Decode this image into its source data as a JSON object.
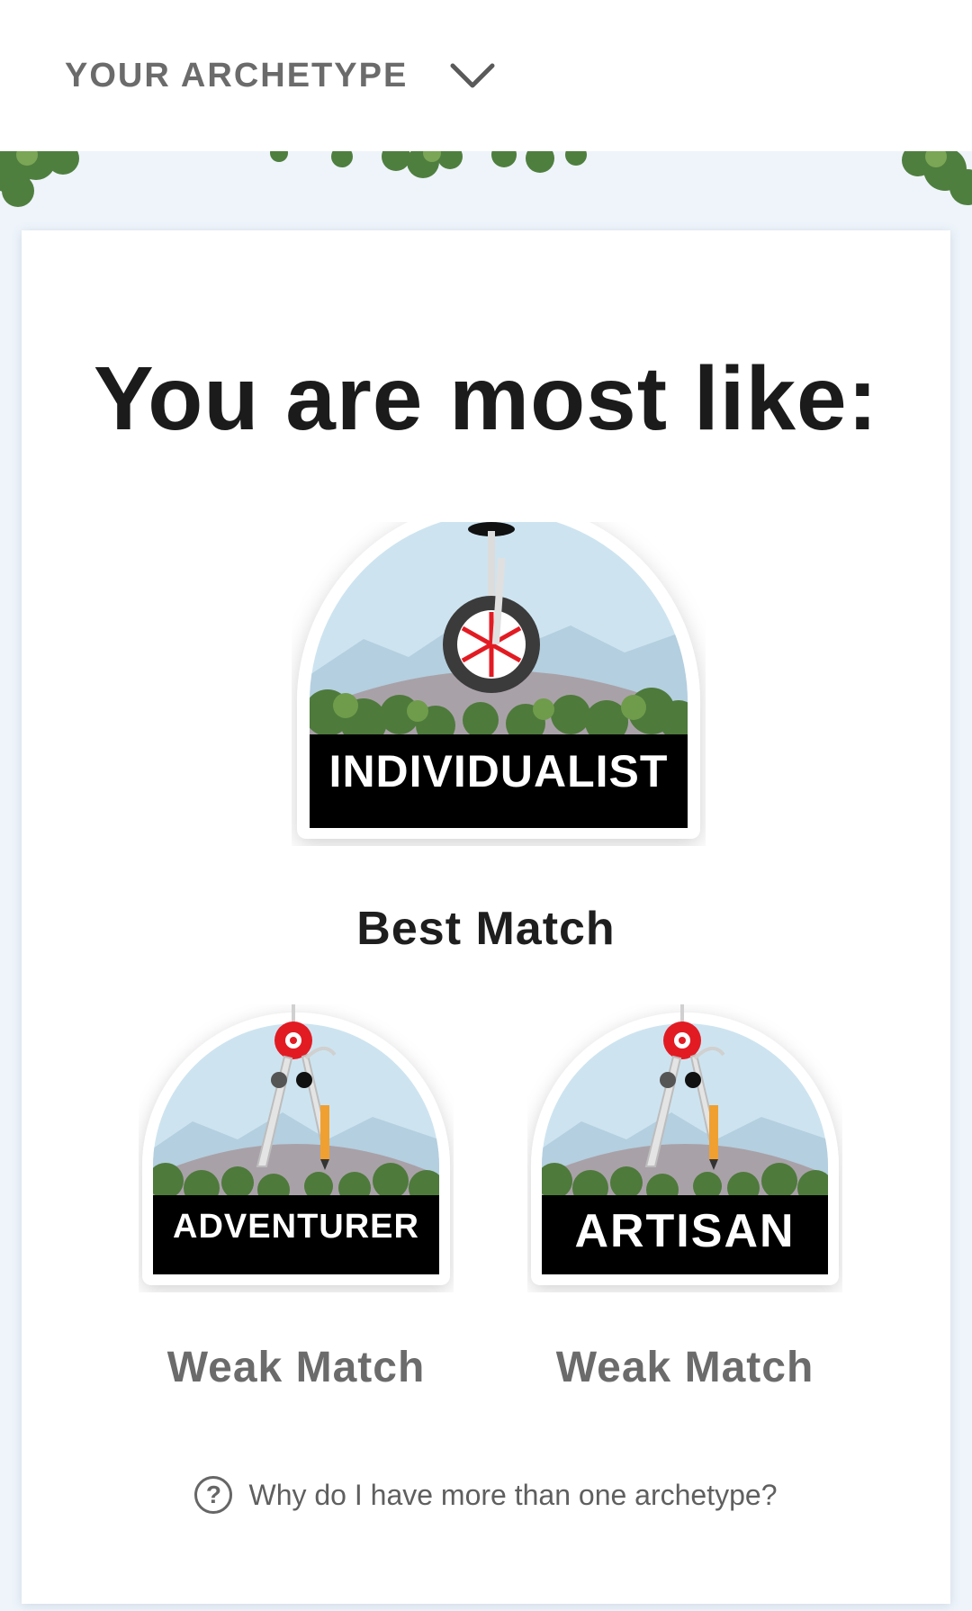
{
  "header": {
    "title": "YOUR ARCHETYPE",
    "toggle_icon": "chevron-down-icon"
  },
  "main": {
    "headline": "You are most like:",
    "archetypes": [
      {
        "name": "INDIVIDUALIST",
        "match": "Best Match",
        "icon": "unicycle-icon"
      },
      {
        "name": "ADVENTURER",
        "match": "Weak Match",
        "icon": "compass-icon"
      },
      {
        "name": "ARTISAN",
        "match": "Weak Match",
        "icon": "compass-icon"
      }
    ],
    "help": {
      "icon": "question-circle-icon",
      "text": "Why do I have more than one archetype?"
    }
  },
  "colors": {
    "sky": "#cde4f0",
    "mountain": "#a9a1a8",
    "foliage_dark": "#3d6b3a",
    "foliage_light": "#6a9a4a",
    "accent_red": "#e21b23",
    "label_bg": "#000000"
  }
}
